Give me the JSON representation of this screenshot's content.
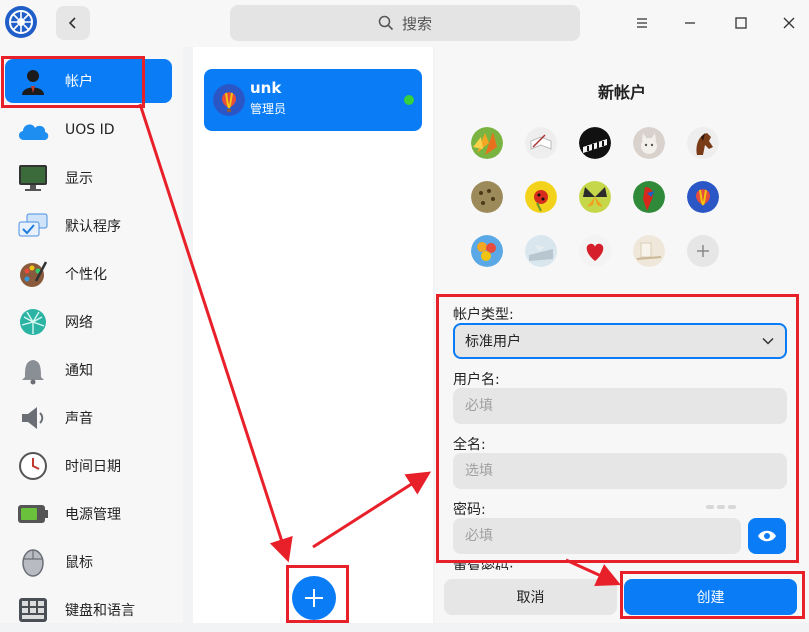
{
  "titlebar": {
    "search_label": "搜索",
    "icons": [
      "app-logo-icon",
      "back-arrow-icon",
      "search-icon",
      "menu-icon",
      "minimize-icon",
      "maximize-icon",
      "close-icon"
    ]
  },
  "sidebar": {
    "items": [
      {
        "label": "帐户",
        "icon": "user-icon"
      },
      {
        "label": "UOS ID",
        "icon": "cloud-icon"
      },
      {
        "label": "显示",
        "icon": "monitor-icon"
      },
      {
        "label": "默认程序",
        "icon": "default-apps-icon"
      },
      {
        "label": "个性化",
        "icon": "palette-icon"
      },
      {
        "label": "网络",
        "icon": "network-icon"
      },
      {
        "label": "通知",
        "icon": "bell-icon"
      },
      {
        "label": "声音",
        "icon": "speaker-icon"
      },
      {
        "label": "时间日期",
        "icon": "clock-icon"
      },
      {
        "label": "电源管理",
        "icon": "battery-icon"
      },
      {
        "label": "鼠标",
        "icon": "mouse-icon"
      },
      {
        "label": "键盘和语言",
        "icon": "keyboard-icon"
      }
    ]
  },
  "accounts": {
    "items": [
      {
        "name": "unk",
        "role": "管理员",
        "online": true
      }
    ]
  },
  "new_account": {
    "title": "新帐户",
    "account_type_label": "帐户类型:",
    "account_type_value": "标准用户",
    "username_label": "用户名:",
    "username_placeholder": "必填",
    "fullname_label": "全名:",
    "fullname_placeholder": "选填",
    "password_label": "密码:",
    "password_placeholder": "必填",
    "repeat_password_label": "重复密码:",
    "cancel_label": "取消",
    "create_label": "创建"
  },
  "colors": {
    "accent": "#0a7cf6",
    "annotation": "#e8202a",
    "online": "#35d03c"
  }
}
